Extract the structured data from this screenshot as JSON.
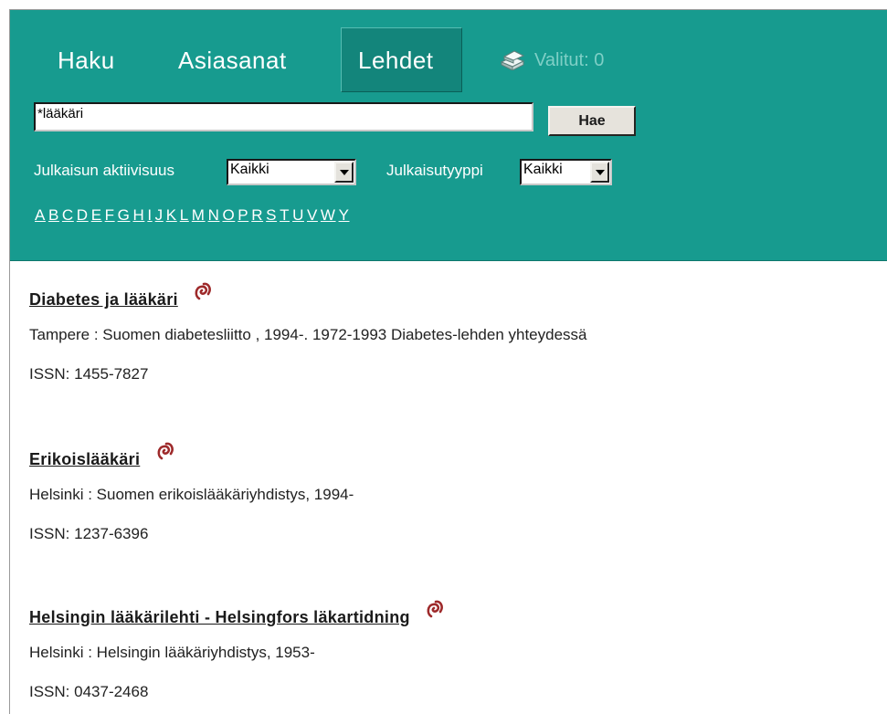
{
  "nav": {
    "tabs": [
      {
        "label": "Haku",
        "active": false
      },
      {
        "label": "Asiasanat",
        "active": false
      },
      {
        "label": "Lehdet",
        "active": true
      }
    ],
    "selected": {
      "label": "Valitut: 0",
      "icon": "books-stack-icon"
    }
  },
  "search": {
    "value": "*lääkäri",
    "button_label": "Hae"
  },
  "filters": {
    "activity": {
      "label": "Julkaisun aktiivisuus",
      "selected": "Kaikki"
    },
    "type": {
      "label": "Julkaisutyyppi",
      "selected": "Kaikki"
    }
  },
  "alphabet": [
    "A",
    "B",
    "C",
    "D",
    "E",
    "F",
    "G",
    "H",
    "I",
    "J",
    "K",
    "L",
    "M",
    "N",
    "O",
    "P",
    "R",
    "S",
    "T",
    "U",
    "V",
    "W",
    "Y"
  ],
  "results": [
    {
      "title": "Diabetes ja lääkäri",
      "publisher": "Tampere : Suomen diabetesliitto , 1994-. 1972-1993 Diabetes-lehden yhteydessä",
      "issn": "ISSN: 1455-7827",
      "icon": "link-resolver-icon"
    },
    {
      "title": "Erikoislääkäri",
      "publisher": "Helsinki : Suomen erikoislääkäriyhdistys, 1994-",
      "issn": "ISSN: 1237-6396",
      "icon": "link-resolver-icon"
    },
    {
      "title": "Helsingin lääkärilehti - Helsingfors läkartidning",
      "publisher": "Helsinki : Helsingin lääkäriyhdistys, 1953-",
      "issn": "ISSN: 0437-2468",
      "icon": "link-resolver-icon"
    }
  ],
  "colors": {
    "header_bg": "#179b8f",
    "active_tab_bg": "#13857b",
    "link_icon": "#9e2a2b"
  }
}
